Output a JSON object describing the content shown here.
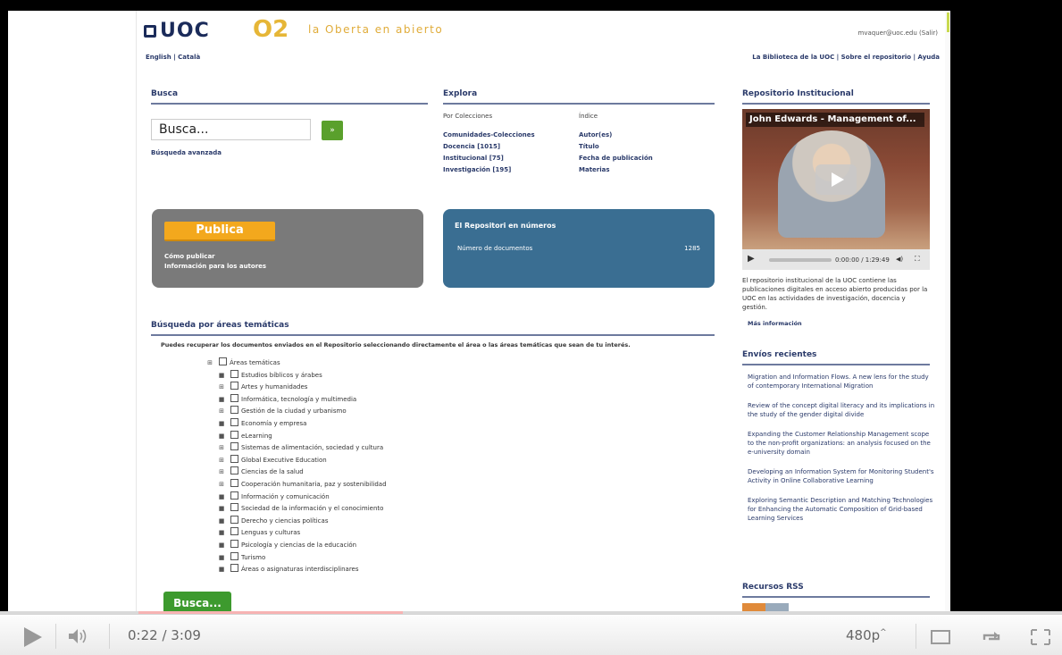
{
  "header": {
    "logo": "UOC",
    "o2": "O2",
    "tagline": "la Oberta en abierto",
    "user": "mvaquer@uoc.edu (Salir)",
    "lang_links": "English | Català",
    "top_links": "La Biblioteca de la UOC | Sobre el repositorio | Ayuda"
  },
  "busca": {
    "title": "Busca",
    "placeholder": "Busca...",
    "go_label": "»",
    "advanced": "Búsqueda avanzada"
  },
  "explora": {
    "title": "Explora",
    "col1_header": "Por Colecciones",
    "col1_items": [
      "Comunidades-Colecciones",
      "Docencia [1015]",
      "Institucional [75]",
      "Investigación [195]"
    ],
    "col2_header": "Índice",
    "col2_items": [
      "Autor(es)",
      "Título",
      "Fecha de publicación",
      "Materias"
    ]
  },
  "publicar": {
    "button": "Publica",
    "links": [
      "Cómo publicar",
      "Información para los autores"
    ]
  },
  "numeros": {
    "title": "El Repositori en números",
    "label": "Número de documentos",
    "value": "1285"
  },
  "areas": {
    "title": "Búsqueda por áreas temáticas",
    "desc": "Puedes recuperar los documentos enviados en el Repositorio seleccionando directamente el área o las áreas temáticas que sean de tu interés.",
    "root": "Áreas temáticas",
    "items": [
      "Estudios bíblicos y árabes",
      "Artes y humanidades",
      "Informática, tecnología y multimedia",
      "Gestión de la ciudad y urbanismo",
      "Economía y empresa",
      "eLearning",
      "Sistemas de alimentación, sociedad y cultura",
      "Global Executive Education",
      "Ciencias de la salud",
      "Cooperación humanitaria, paz y sostenibilidad",
      "Información y comunicación",
      "Sociedad de la información y el conocimiento",
      "Derecho y ciencias políticas",
      "Lenguas y culturas",
      "Psicología y ciencias de la educación",
      "Turismo",
      "Áreas o asignaturas interdisciplinares"
    ],
    "toggles": [
      "■",
      "⊞",
      "■",
      "⊞",
      "■",
      "■",
      "⊞",
      "⊞",
      "⊞",
      "⊞",
      "■",
      "■",
      "■",
      "■",
      "■",
      "■",
      "■"
    ],
    "busca_button": "Busca..."
  },
  "repositorio": {
    "title": "Repositorio Institucional",
    "video_title": "John Edwards - Management of...",
    "video_time": "0:00:00 / 1:29:49",
    "desc": "El repositorio institucional de la UOC contiene las publicaciones digitales en acceso abierto producidas por la UOC en las actividades de investigación, docencia y gestión.",
    "more": "Más información"
  },
  "envios": {
    "title": "Envíos recientes",
    "items": [
      "Migration and Information Flows. A new lens for the study of contemporary International Migration",
      "Review of the concept digital literacy and its implications in the study of the gender digital divide",
      "Expanding the Customer Relationship Management scope to the non-profit organizations: an analysis focused on the e-university domain",
      "Developing an Information System for Monitoring Student's Activity in Online Collaborative Learning",
      "Exploring Semantic Description and Matching Technologies for Enhancing the Automatic Composition of Grid-based Learning Services"
    ]
  },
  "rss": {
    "title": "Recursos RSS"
  },
  "player": {
    "current": "0:22",
    "duration": "3:09",
    "time_display": "0:22 / 3:09",
    "quality": "480p",
    "progress_fraction": 0.116,
    "loaded_fraction": 0.365
  }
}
